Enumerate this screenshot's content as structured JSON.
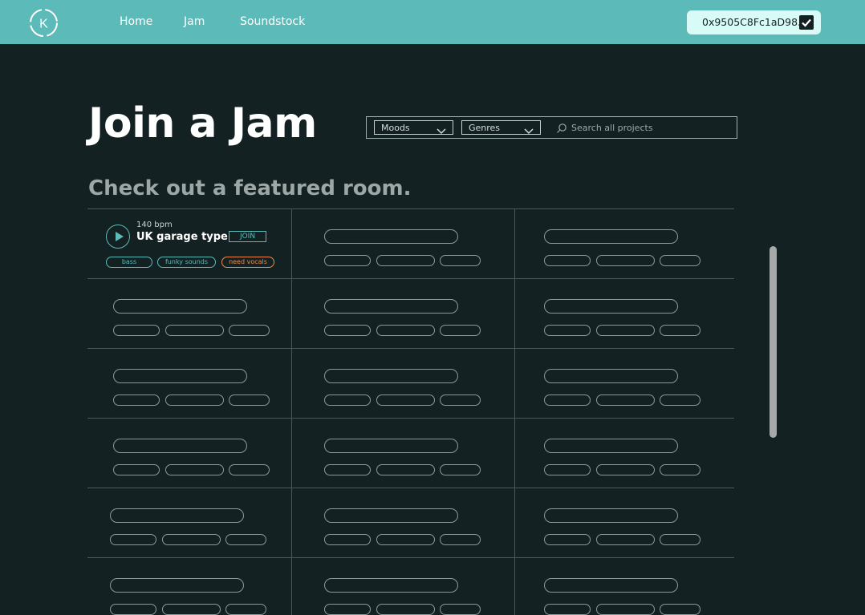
{
  "nav": {
    "logo_letter": "K",
    "links": [
      "Home",
      "Jam",
      "Soundstock"
    ],
    "wallet_address": "0x9505C8Fc1aD98..."
  },
  "page": {
    "title": "Join a Jam",
    "subtitle": "Check out a featured room."
  },
  "filters": {
    "moods_label": "Moods",
    "genres_label": "Genres",
    "search_placeholder": "Search all projects"
  },
  "featured_room": {
    "bpm": "140 bpm",
    "name": "UK garage type",
    "join_label": "JOIN",
    "tags": [
      "bass",
      "funky sounds",
      "need vocals"
    ]
  },
  "colors": {
    "background": "#132123",
    "accent": "#5cbbb8",
    "tag_orange": "#f08a4b",
    "wallet_bg": "#d8fbf8"
  }
}
